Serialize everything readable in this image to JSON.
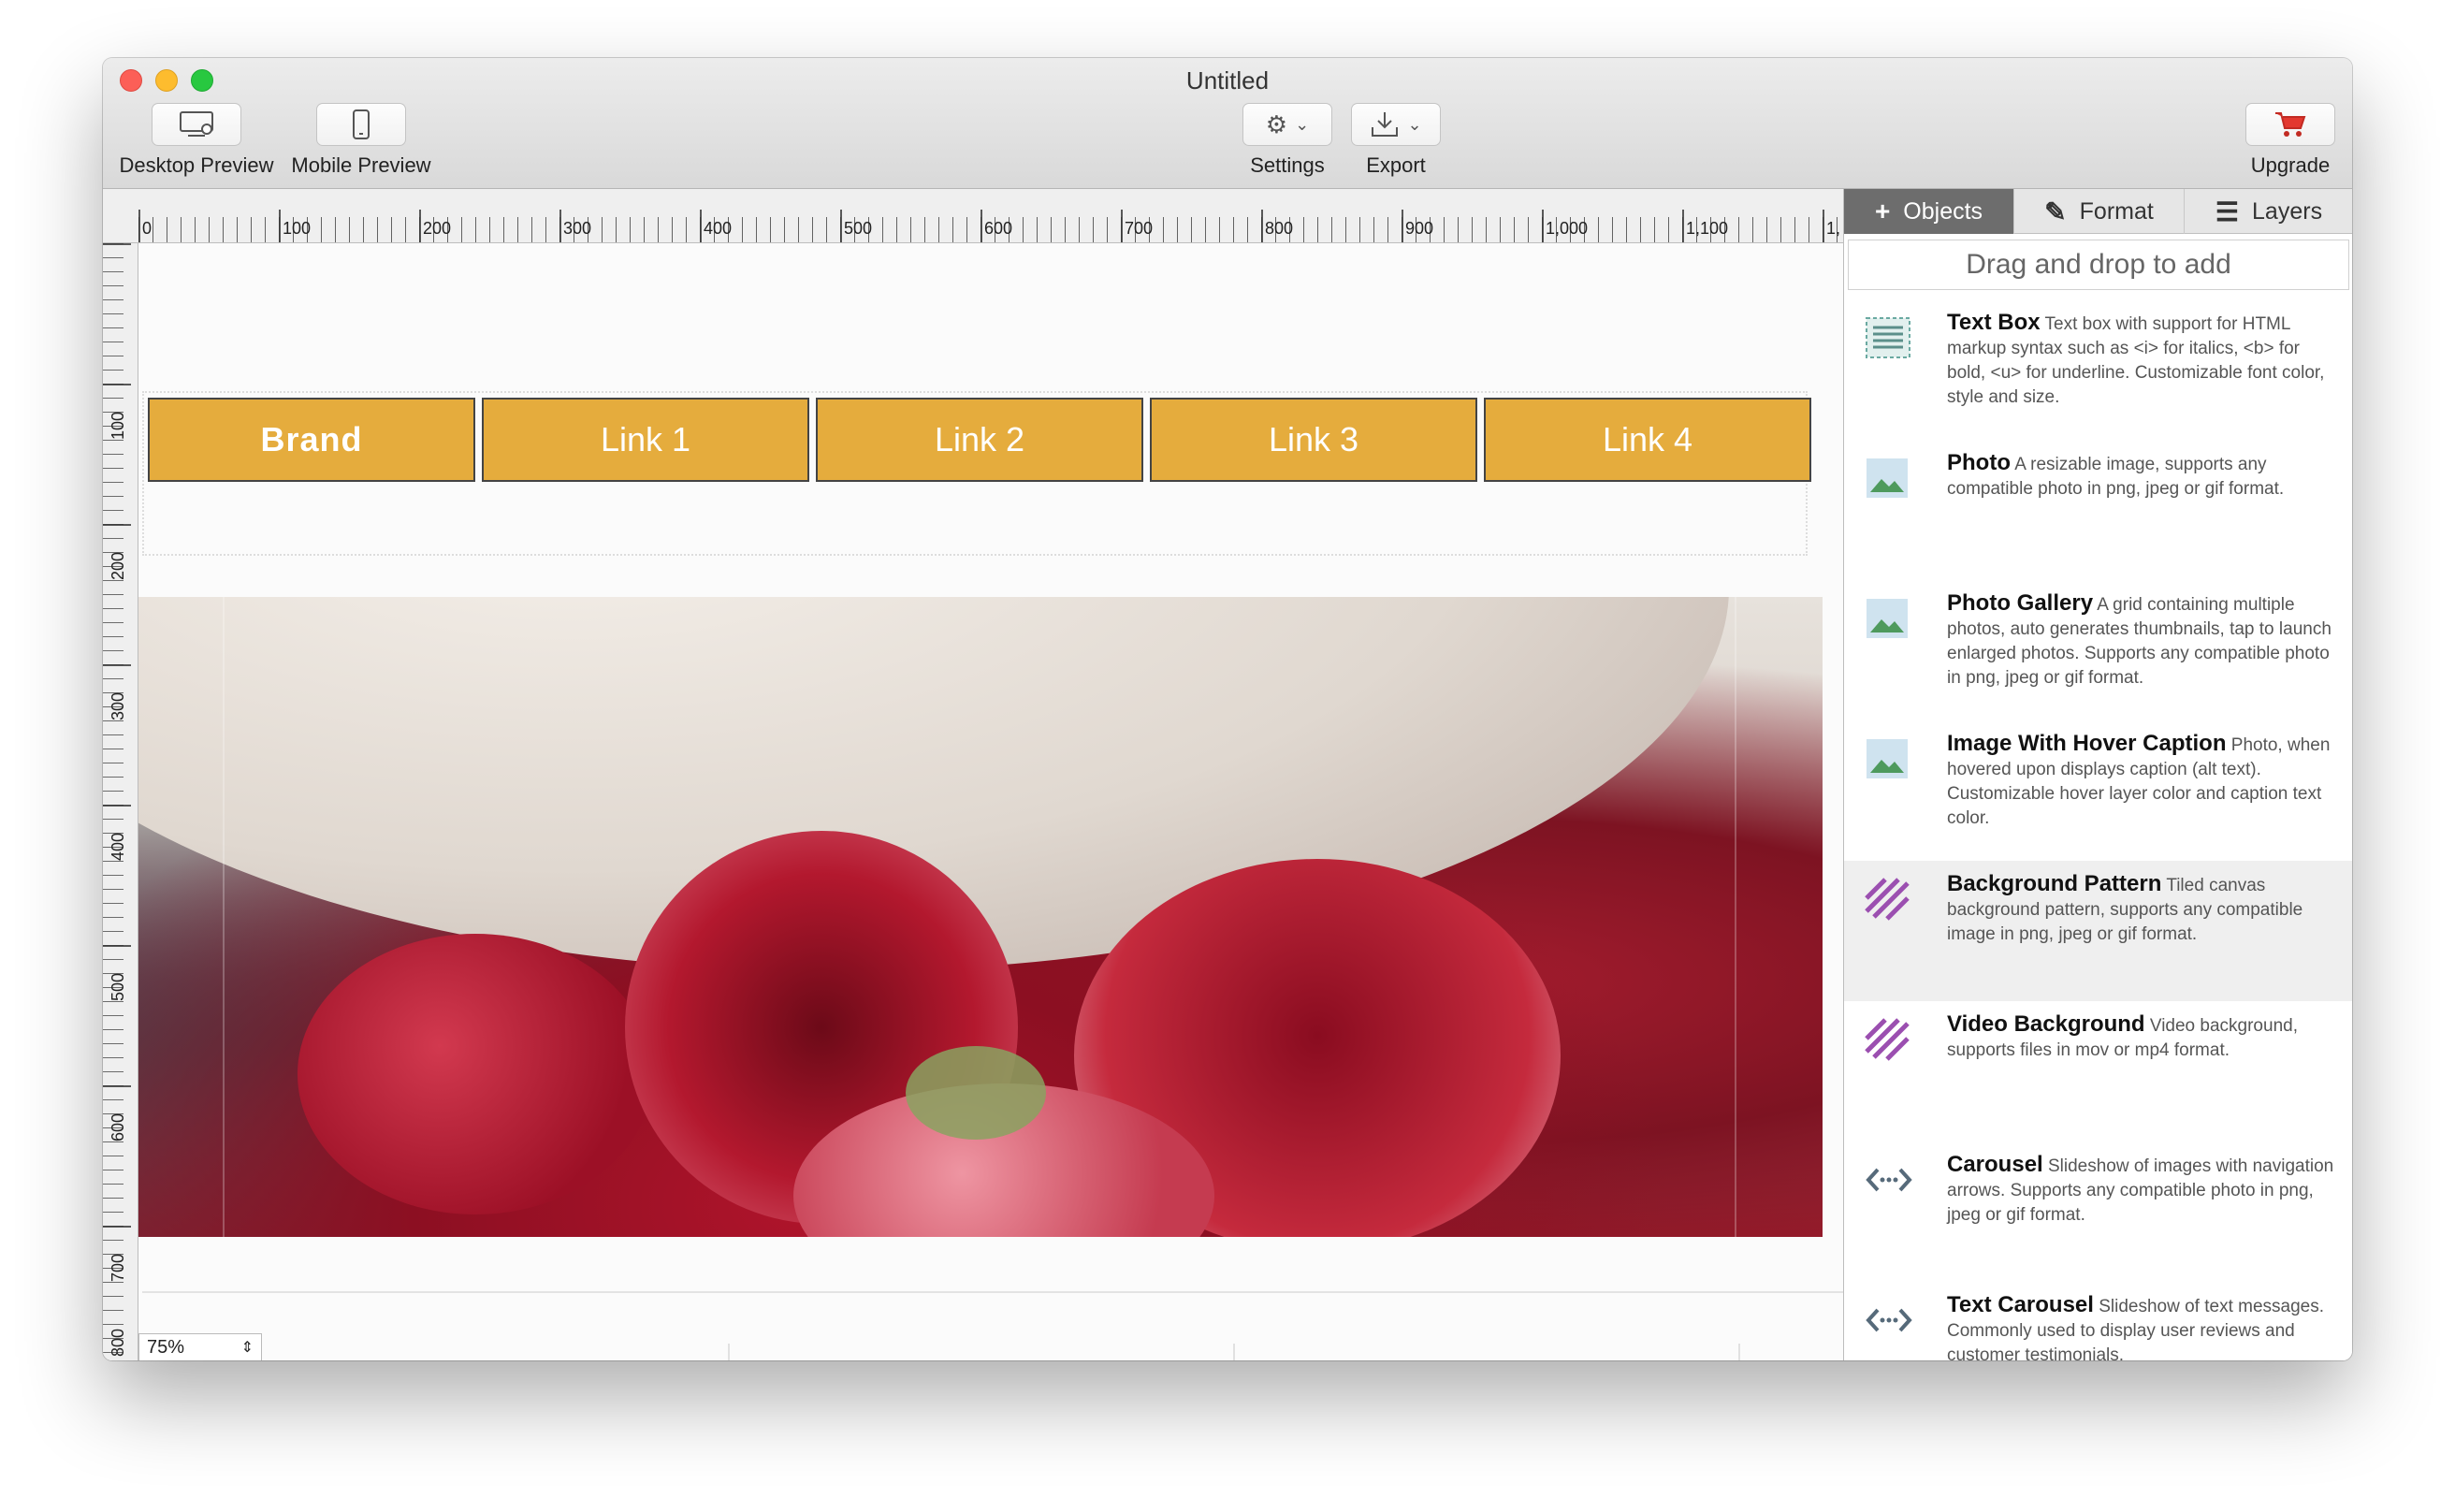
{
  "window": {
    "title": "Untitled",
    "toolbar": {
      "desktop_preview": "Desktop Preview",
      "mobile_preview": "Mobile Preview",
      "settings": "Settings",
      "export": "Export",
      "upgrade": "Upgrade"
    }
  },
  "ruler": {
    "top_labels": [
      "0",
      "100",
      "200",
      "300",
      "400",
      "500",
      "600",
      "700",
      "800",
      "900",
      "1,000",
      "1,100",
      "1,"
    ],
    "left_labels": [
      "100",
      "200",
      "300",
      "400",
      "500",
      "600",
      "700",
      "800"
    ]
  },
  "canvas": {
    "nav": {
      "brand": "Brand",
      "links": [
        "Link 1",
        "Link 2",
        "Link 3",
        "Link 4"
      ],
      "color": "#e5ac3d"
    },
    "zoom": "75%"
  },
  "panel": {
    "tabs": {
      "objects": "Objects",
      "format": "Format",
      "layers": "Layers"
    },
    "drag_hint": "Drag and drop to add",
    "objects": [
      {
        "name": "Text Box",
        "desc": "Text box with support for HTML markup syntax such as <i> for italics, <b> for bold, <u> for underline. Customizable font color, style and size.",
        "icon": "text-box-icon"
      },
      {
        "name": "Photo",
        "desc": "A resizable image, supports any compatible photo in png, jpeg or gif format.",
        "icon": "photo-icon"
      },
      {
        "name": "Photo Gallery",
        "desc": "A grid containing multiple photos, auto generates thumbnails, tap to launch enlarged photos. Supports any compatible photo in png, jpeg or gif format.",
        "icon": "photo-icon"
      },
      {
        "name": "Image With Hover Caption",
        "desc": "Photo, when hovered upon displays caption (alt text). Customizable hover layer color and caption text color.",
        "icon": "photo-icon"
      },
      {
        "name": "Background Pattern",
        "desc": "Tiled canvas background pattern, supports any compatible image in png, jpeg or gif format.",
        "icon": "pattern-icon"
      },
      {
        "name": "Video Background",
        "desc": "Video background, supports files in mov or mp4 format.",
        "icon": "pattern-icon"
      },
      {
        "name": "Carousel",
        "desc": "Slideshow of images with navigation arrows.  Supports any compatible photo in png, jpeg or gif format.",
        "icon": "carousel-icon"
      },
      {
        "name": "Text Carousel",
        "desc": "Slideshow of text messages.  Commonly used to display user reviews and customer testimonials.",
        "icon": "carousel-icon"
      }
    ]
  }
}
